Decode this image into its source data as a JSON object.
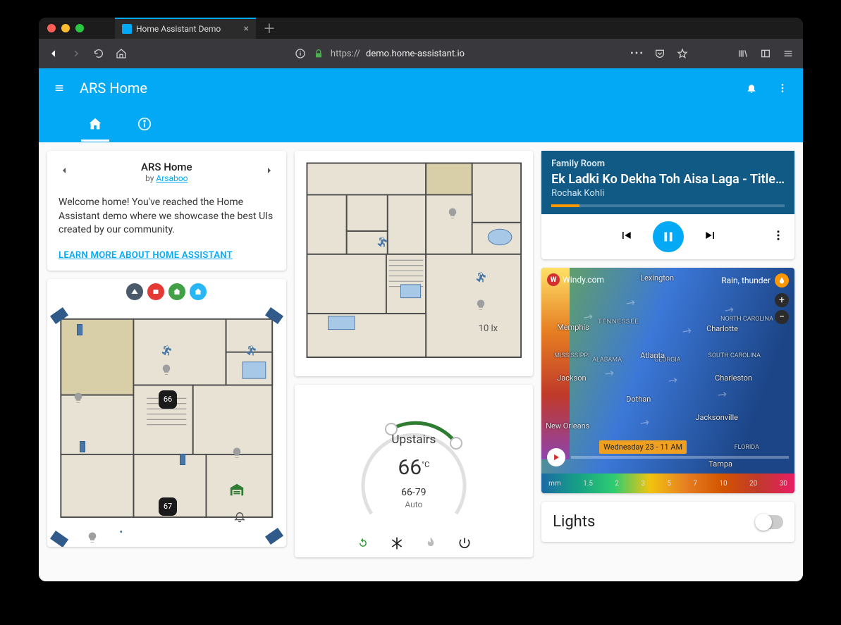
{
  "browser": {
    "tab_title": "Home Assistant Demo",
    "url_prefix": "https://",
    "url_host": "demo.home-assistant.io",
    "url_path": ""
  },
  "header": {
    "title": "ARS Home"
  },
  "welcome": {
    "title": "ARS Home",
    "by_prefix": "by ",
    "author": "Arsaboo",
    "body": "Welcome home! You've reached the Home Assistant demo where we showcase the best UIs created by our community.",
    "learn": "LEARN MORE ABOUT HOME ASSISTANT"
  },
  "floorplan_main": {
    "badges": [
      "66",
      "67"
    ],
    "status_colors": [
      "#4a5a6a",
      "#e53935",
      "#43a047",
      "#29b6f6"
    ]
  },
  "floorplan_upstairs": {
    "lux_label": "10 lx"
  },
  "thermostat": {
    "name": "Upstairs",
    "current": "66",
    "unit": "°C",
    "range": "66-79",
    "mode": "Auto"
  },
  "media_player": {
    "room": "Family Room",
    "title": "Ek Ladki Ko Dekha Toh Aisa Laga - Title…",
    "artist": "Rochak Kohli",
    "progress_pct": 12
  },
  "weather": {
    "brand": "Windy.com",
    "layer": "Rain, thunder",
    "timeline_label": "Wednesday 23 - 11 AM",
    "cities": {
      "lexington": "Lexington",
      "memphis": "Memphis",
      "tennessee": "TENNESSEE",
      "nc": "NORTH CAROLINA",
      "charlotte": "Charlotte",
      "mississippi": "MISSISSIPPI",
      "alabama": "ALABAMA",
      "georgia": "GEORGIA",
      "atlanta": "Atlanta",
      "sc": "SOUTH CAROLINA",
      "charleston": "Charleston",
      "jackson": "Jackson",
      "dothan": "Dothan",
      "neworleans": "New Orleans",
      "jacksonville": "Jacksonville",
      "florida": "FLORIDA",
      "tampa": "Tampa"
    },
    "legend_unit": "mm",
    "legend": [
      "1.5",
      "2",
      "3",
      "5",
      "7",
      "10",
      "20",
      "30"
    ]
  },
  "lights": {
    "title": "Lights",
    "on": false
  }
}
